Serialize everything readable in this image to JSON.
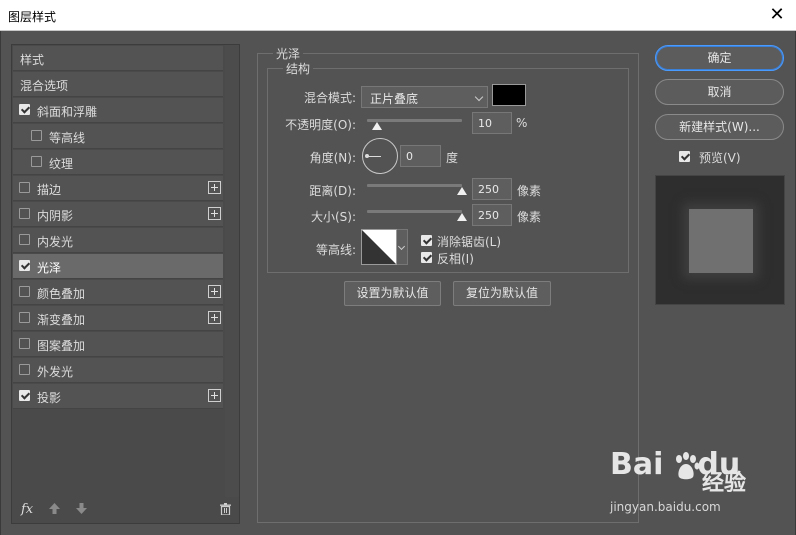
{
  "window": {
    "title": "图层样式",
    "close_glyph": "✕"
  },
  "styles": [
    {
      "label": "样式",
      "checkbox": false,
      "checked": false,
      "plus": false,
      "selected": false,
      "indent": false
    },
    {
      "label": "混合选项",
      "checkbox": false,
      "checked": false,
      "plus": false,
      "selected": false,
      "indent": false
    },
    {
      "label": "斜面和浮雕",
      "checkbox": true,
      "checked": true,
      "plus": false,
      "selected": false,
      "indent": false
    },
    {
      "label": "等高线",
      "checkbox": true,
      "checked": false,
      "plus": false,
      "selected": false,
      "indent": true
    },
    {
      "label": "纹理",
      "checkbox": true,
      "checked": false,
      "plus": false,
      "selected": false,
      "indent": true
    },
    {
      "label": "描边",
      "checkbox": true,
      "checked": false,
      "plus": true,
      "selected": false,
      "indent": false
    },
    {
      "label": "内阴影",
      "checkbox": true,
      "checked": false,
      "plus": true,
      "selected": false,
      "indent": false
    },
    {
      "label": "内发光",
      "checkbox": true,
      "checked": false,
      "plus": false,
      "selected": false,
      "indent": false
    },
    {
      "label": "光泽",
      "checkbox": true,
      "checked": true,
      "plus": false,
      "selected": true,
      "indent": false
    },
    {
      "label": "颜色叠加",
      "checkbox": true,
      "checked": false,
      "plus": true,
      "selected": false,
      "indent": false
    },
    {
      "label": "渐变叠加",
      "checkbox": true,
      "checked": false,
      "plus": true,
      "selected": false,
      "indent": false
    },
    {
      "label": "图案叠加",
      "checkbox": true,
      "checked": false,
      "plus": false,
      "selected": false,
      "indent": false
    },
    {
      "label": "外发光",
      "checkbox": true,
      "checked": false,
      "plus": false,
      "selected": false,
      "indent": false
    },
    {
      "label": "投影",
      "checkbox": true,
      "checked": true,
      "plus": true,
      "selected": false,
      "indent": false
    }
  ],
  "bottom_bar": {
    "fx_label": "fx"
  },
  "satin": {
    "group_title": "光泽",
    "structure_title": "结构",
    "blend_mode": {
      "label": "混合模式:",
      "value": "正片叠底",
      "color": "#000000"
    },
    "opacity": {
      "label": "不透明度(O):",
      "value": "10",
      "unit": "%",
      "fraction": 0.1
    },
    "angle": {
      "label": "角度(N):",
      "value": "0",
      "unit": "度"
    },
    "distance": {
      "label": "距离(D):",
      "value": "250",
      "unit": "像素",
      "fraction": 1.0
    },
    "size": {
      "label": "大小(S):",
      "value": "250",
      "unit": "像素",
      "fraction": 1.0
    },
    "contour": {
      "label": "等高线:"
    },
    "anti_alias": {
      "label": "消除锯齿(L)",
      "checked": true
    },
    "invert": {
      "label": "反相(I)",
      "checked": true
    },
    "make_default": "设置为默认值",
    "reset_default": "复位为默认值"
  },
  "right": {
    "ok": "确定",
    "cancel": "取消",
    "new_style": "新建样式(W)...",
    "preview": {
      "label": "预览(V)",
      "checked": true
    }
  },
  "watermark": {
    "brand": "Bai",
    "brand_tail": "du",
    "cn": "经验",
    "url": "jingyan.baidu.com"
  }
}
